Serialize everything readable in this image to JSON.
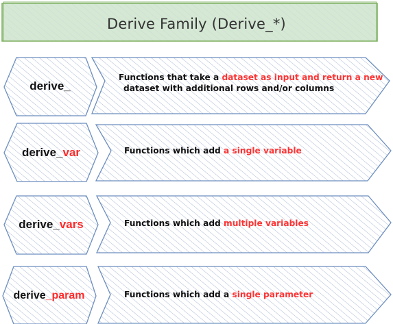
{
  "title": "Derive Family (Derive_*)",
  "colors": {
    "title_fill": "#d5e8d4",
    "title_stroke": "#82b366",
    "shape_stroke": "#6c8ebf",
    "hatch": "#a9b8d6",
    "highlight": "#ff3333",
    "text": "#111111"
  },
  "rows": [
    {
      "name_prefix": "derive_",
      "name_highlight": "",
      "desc_before": "Functions that take a ",
      "desc_highlight": "dataset as input and return a new",
      "desc_after": "",
      "desc_line2": "dataset with additional rows and/or columns"
    },
    {
      "name_prefix": "derive_",
      "name_highlight": "var",
      "desc_before": "Functions which add ",
      "desc_highlight": "a single variable",
      "desc_after": "",
      "desc_line2": ""
    },
    {
      "name_prefix": "derive_",
      "name_highlight": "vars",
      "desc_before": "Functions which add ",
      "desc_highlight": "multiple variables",
      "desc_after": "",
      "desc_line2": ""
    },
    {
      "name_prefix": "derive",
      "name_highlight": "_param",
      "desc_before": "Functions which add a ",
      "desc_highlight": "single parameter",
      "desc_after": "",
      "desc_line2": ""
    }
  ]
}
